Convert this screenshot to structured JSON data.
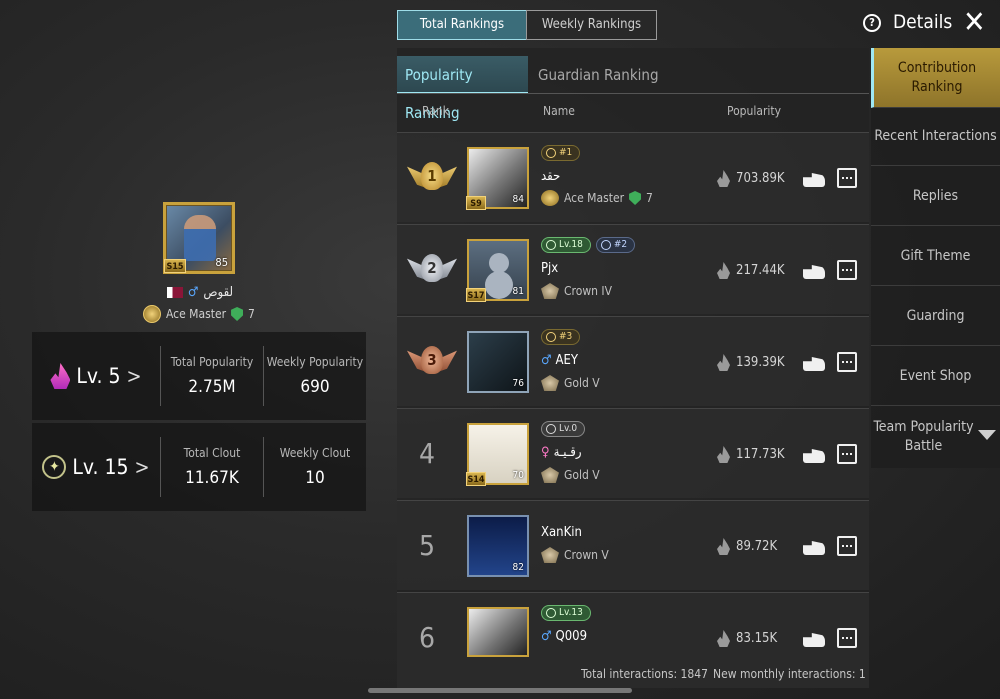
{
  "top_tabs": [
    "Total Rankings",
    "Weekly Rankings"
  ],
  "header": {
    "details_label": "Details",
    "help_icon": "?",
    "close_icon": "✕"
  },
  "sub_tabs": [
    "Popularity Ranking",
    "Guardian Ranking"
  ],
  "columns": {
    "rank": "Rank",
    "name": "Name",
    "popularity": "Popularity"
  },
  "profile": {
    "name": "لقوص",
    "season": "S15",
    "frame_level": "85",
    "rank_title": "Ace Master",
    "rank_stars": "7",
    "popularity_panel": {
      "level": "Lv. 5",
      "total_label": "Total Popularity",
      "total_value": "2.75M",
      "weekly_label": "Weekly Popularity",
      "weekly_value": "690"
    },
    "clout_panel": {
      "level": "Lv. 15",
      "total_label": "Total Clout",
      "total_value": "11.67K",
      "weekly_label": "Weekly Clout",
      "weekly_value": "10"
    }
  },
  "rows": [
    {
      "rank": "1",
      "name": "حقد",
      "tag1": "#1",
      "rank_title": "Ace Master",
      "stars": "7",
      "season": "S9",
      "frame_level": "84",
      "popularity": "703.89K"
    },
    {
      "rank": "2",
      "name": "Pjx",
      "tag1": "Lv.18",
      "tag2": "#2",
      "rank_title": "Crown IV",
      "season": "S17",
      "frame_level": "81",
      "popularity": "217.44K"
    },
    {
      "rank": "3",
      "name": "AEY",
      "tag1": "#3",
      "rank_title": "Gold V",
      "frame_level": "76",
      "popularity": "139.39K"
    },
    {
      "rank": "4",
      "name": "رقـيـة",
      "tag1": "Lv.0",
      "rank_title": "Gold V",
      "season": "S14",
      "frame_level": "70",
      "popularity": "117.73K"
    },
    {
      "rank": "5",
      "name": "XanKin",
      "rank_title": "Crown V",
      "frame_level": "82",
      "popularity": "89.72K"
    },
    {
      "rank": "6",
      "name": "Q009",
      "tag1": "Lv.13",
      "popularity": "83.15K"
    }
  ],
  "side_menu": [
    "Contribution Ranking",
    "Recent Interactions",
    "Replies",
    "Gift Theme",
    "Guarding",
    "Event Shop",
    "Team Popularity Battle"
  ],
  "footer": {
    "total_interactions": "Total interactions: 1847",
    "monthly_interactions": "New monthly interactions: 1"
  },
  "icons": {
    "male": "♂",
    "female": "♀",
    "chevron": ">"
  }
}
